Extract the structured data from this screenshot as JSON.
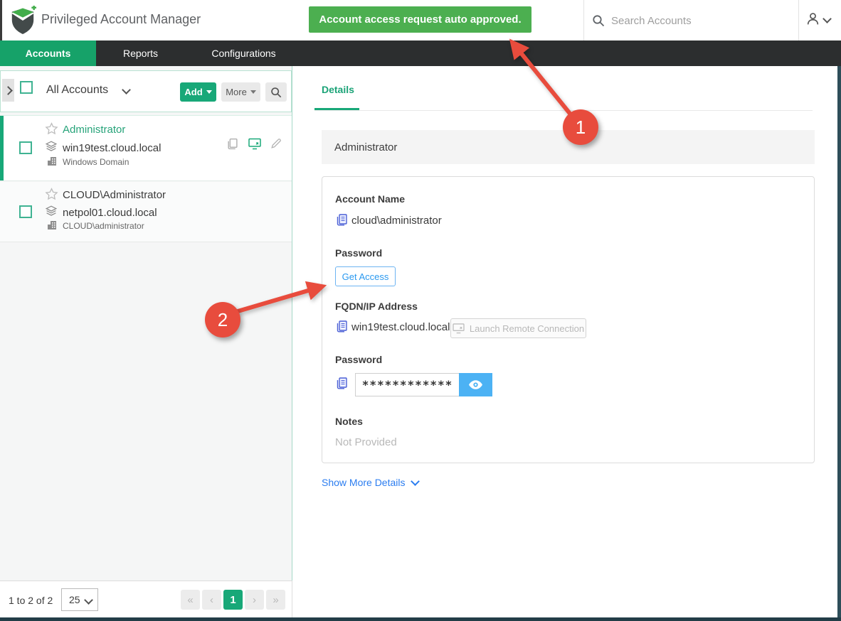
{
  "header": {
    "app_title": "Privileged Account Manager",
    "toast": "Account access request auto approved.",
    "search_placeholder": "Search Accounts"
  },
  "nav": {
    "tabs": [
      {
        "label": "Accounts",
        "active": true
      },
      {
        "label": "Reports",
        "active": false
      },
      {
        "label": "Configurations",
        "active": false
      }
    ]
  },
  "sidebar": {
    "title": "All Accounts",
    "add_label": "Add",
    "more_label": "More",
    "accounts": [
      {
        "name": "Administrator",
        "fqdn": "win19test.cloud.local",
        "type": "Windows Domain",
        "selected": true
      },
      {
        "name": "CLOUD\\Administrator",
        "fqdn": "netpol01.cloud.local",
        "type": "CLOUD\\administrator",
        "selected": false
      }
    ],
    "pagination": {
      "range_text": "1 to 2 of 2",
      "page_size": "25",
      "first": "«",
      "prev": "‹",
      "current_page": "1",
      "next": "›",
      "last": "»"
    }
  },
  "main": {
    "tab_label": "Details",
    "section_title": "Administrator",
    "account_name_label": "Account Name",
    "account_name_value": "cloud\\administrator",
    "password_label": "Password",
    "get_access_label": "Get Access",
    "fqdn_label": "FQDN/IP Address",
    "fqdn_value": "win19test.cloud.local",
    "launch_remote_label": "Launch Remote Connection",
    "password2_label": "Password",
    "password_masked": "************",
    "notes_label": "Notes",
    "notes_value": "Not Provided",
    "show_more_label": "Show More Details"
  },
  "annotations": {
    "step1": "1",
    "step2": "2"
  },
  "colors": {
    "accent_green": "#18a878",
    "nav_active_green": "#16a269",
    "toast_green": "#4caf50",
    "link_blue": "#2b7df0",
    "eye_button_blue": "#4cb2f4",
    "arrow_red": "#e84c3d",
    "nav_dark": "#2c2e2f"
  }
}
